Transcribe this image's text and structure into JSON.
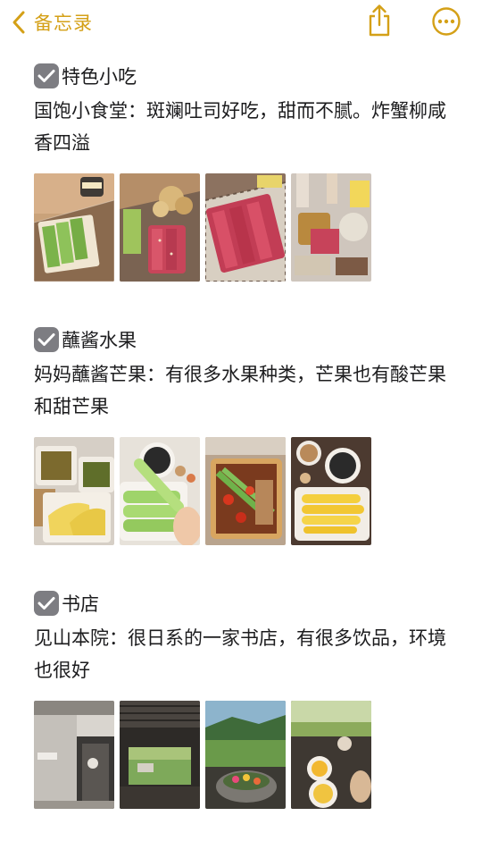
{
  "nav": {
    "back_label": "备忘录",
    "icons": {
      "back": "chevron-left-icon",
      "share": "share-icon",
      "more": "ellipsis-circle-icon"
    },
    "accent_color": "#d4a017"
  },
  "sections": [
    {
      "title": "特色小吃",
      "checked": true,
      "text": "国饱小食堂：斑斓吐司好吃，甜而不腻。炸蟹柳咸香四溢",
      "photo_count": 4
    },
    {
      "title": "蘸酱水果",
      "checked": true,
      "text": "妈妈蘸酱芒果：有很多水果种类，芒果也有酸芒果和甜芒果",
      "photo_count": 4
    },
    {
      "title": "书店",
      "checked": true,
      "text": "见山本院：很日系的一家书店，有很多饮品，环境也很好",
      "photo_count": 4
    }
  ]
}
